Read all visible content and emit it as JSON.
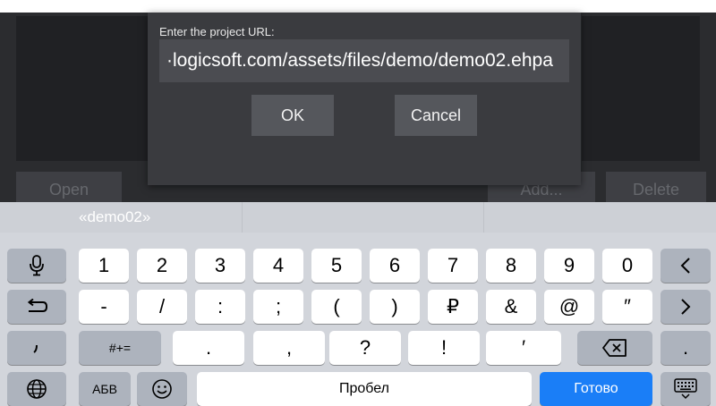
{
  "app": {
    "buttons": {
      "open": "Open",
      "add": "Add...",
      "delete": "Delete"
    }
  },
  "dialog": {
    "label": "Enter the project URL:",
    "url_value": "·logicsoft.com/assets/files/demo/demo02.ehpa",
    "ok": "OK",
    "cancel": "Cancel"
  },
  "keyboard": {
    "suggestion": "«demo02»",
    "row1": [
      "1",
      "2",
      "3",
      "4",
      "5",
      "6",
      "7",
      "8",
      "9",
      "0"
    ],
    "row2": [
      "-",
      "/",
      ":",
      ";",
      "(",
      ")",
      "₽",
      "&",
      "@",
      "″"
    ],
    "row3": [
      ".",
      ",",
      "?",
      "!",
      "′"
    ],
    "labels": {
      "symbols": "#+=",
      "abc": "АБВ",
      "space": "Пробел",
      "done": "Готово",
      "dot_right": "."
    },
    "icons": {
      "mic": "microphone-icon",
      "backspace_arrow": "left-arrow-icon",
      "undo": "undo-icon",
      "forward": "right-arrow-icon",
      "comma_left": "comma",
      "delete": "backspace-icon",
      "globe": "globe-icon",
      "emoji": "emoji-icon",
      "hide": "keyboard-dismiss-icon"
    }
  }
}
